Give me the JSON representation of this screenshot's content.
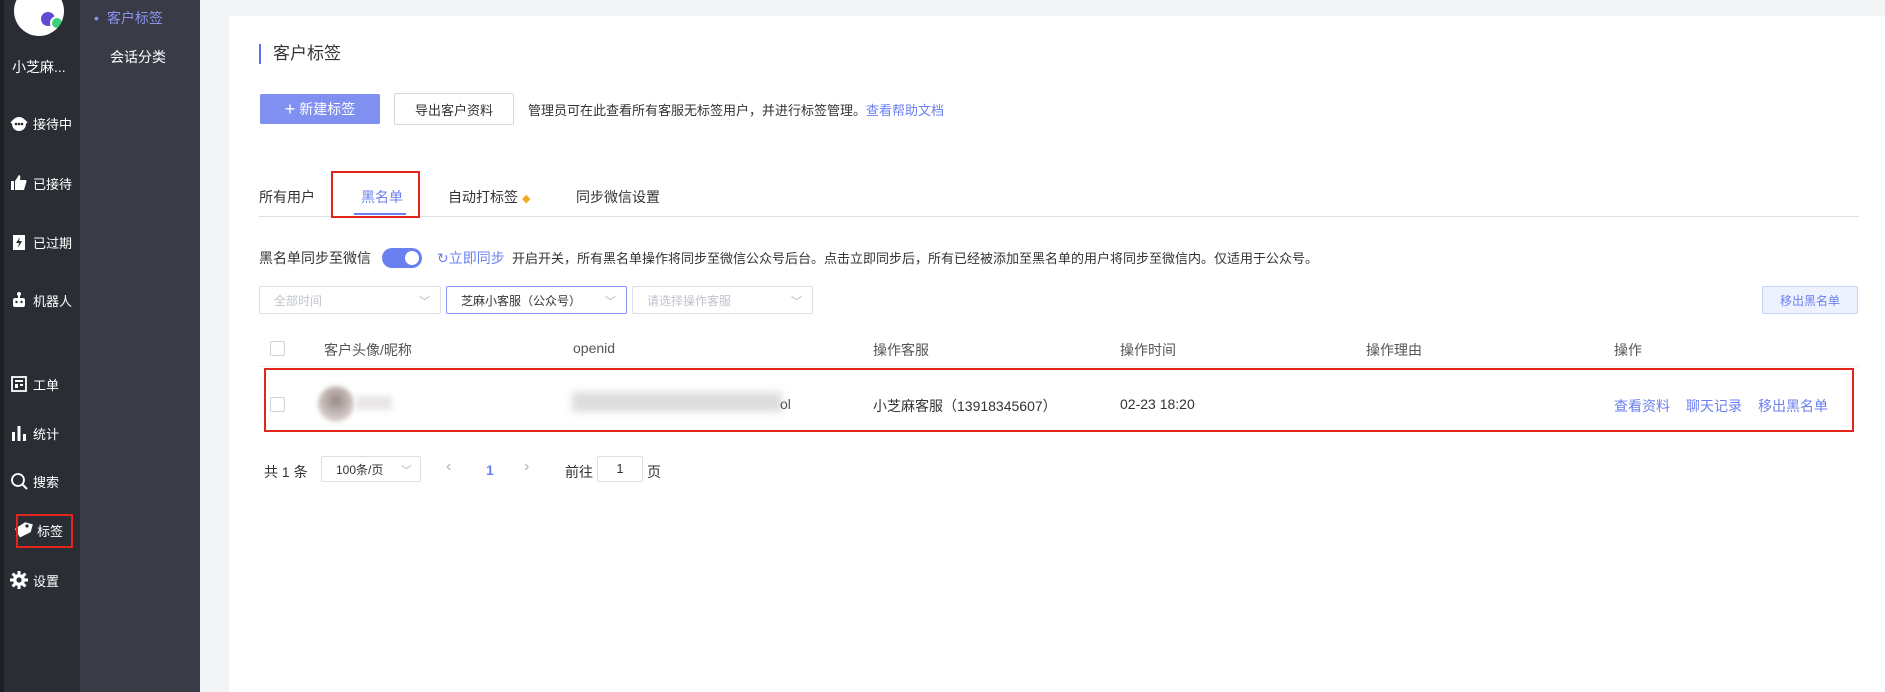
{
  "rail": {
    "user_name": "小芝麻...",
    "items": [
      {
        "label": "接待中",
        "icon": "headset-icon"
      },
      {
        "label": "已接待",
        "icon": "thumbs-up-icon"
      },
      {
        "label": "已过期",
        "icon": "expired-icon"
      },
      {
        "label": "机器人",
        "icon": "robot-icon"
      },
      {
        "label": "工单",
        "icon": "ticket-icon"
      },
      {
        "label": "统计",
        "icon": "bar-chart-icon"
      },
      {
        "label": "搜索",
        "icon": "search-icon"
      },
      {
        "label": "标签",
        "icon": "tag-icon"
      },
      {
        "label": "设置",
        "icon": "gear-icon"
      }
    ]
  },
  "subnav": {
    "items": [
      {
        "label": "客户标签",
        "active": true
      },
      {
        "label": "会话分类",
        "active": false
      }
    ]
  },
  "page": {
    "title": "客户标签",
    "new_tag_button": "新建标签",
    "export_button": "导出客户资料",
    "tip_text": "管理员可在此查看所有客服无标签用户，并进行标签管理。",
    "help_link": "查看帮助文档"
  },
  "tabs": [
    {
      "label": "所有用户",
      "active": false
    },
    {
      "label": "黑名单",
      "active": true
    },
    {
      "label": "自动打标签",
      "active": false
    },
    {
      "label": "同步微信设置",
      "active": false
    }
  ],
  "sync": {
    "label": "黑名单同步至微信",
    "enabled": true,
    "sync_now": "立即同步",
    "description": "开启开关，所有黑名单操作将同步至微信公众号后台。点击立即同步后，所有已经被添加至黑名单的用户将同步至微信内。仅适用于公众号。"
  },
  "filters": {
    "time_placeholder": "全部时间",
    "account_selected": "芝麻小客服（公众号）",
    "operator_placeholder": "请选择操作客服",
    "remove_button": "移出黑名单"
  },
  "table": {
    "headers": [
      "客户头像/昵称",
      "openid",
      "操作客服",
      "操作时间",
      "操作理由",
      "操作"
    ],
    "rows": [
      {
        "openid_tail": "ol",
        "operator": "小芝麻客服（13918345607）",
        "time": "02-23 18:20",
        "reason": "",
        "actions": [
          "查看资料",
          "聊天记录",
          "移出黑名单"
        ]
      }
    ]
  },
  "pagination": {
    "total": "共 1 条",
    "page_size": "100条/页",
    "current_page": "1",
    "goto_prefix": "前往",
    "goto_value": "1",
    "goto_suffix": "页"
  }
}
